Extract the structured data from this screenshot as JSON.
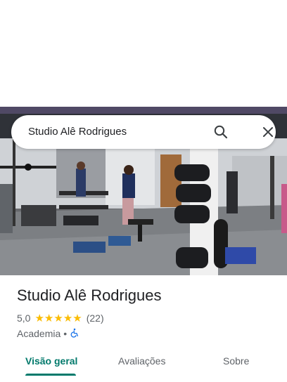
{
  "search": {
    "query": "Studio Alê Rodrigues"
  },
  "place": {
    "title": "Studio Alê Rodrigues",
    "rating": "5,0",
    "stars": 5,
    "review_count": "(22)",
    "category": "Academia",
    "separator": "•"
  },
  "tabs": [
    {
      "label": "Visão geral",
      "active": true
    },
    {
      "label": "Avaliações",
      "active": false
    },
    {
      "label": "Sobre",
      "active": false
    }
  ],
  "colors": {
    "accent": "#00796b",
    "star": "#fbbc04",
    "accessibility": "#1a73e8"
  },
  "icons": {
    "search": "search-icon",
    "close": "close-icon",
    "accessibility": "wheelchair-icon"
  }
}
